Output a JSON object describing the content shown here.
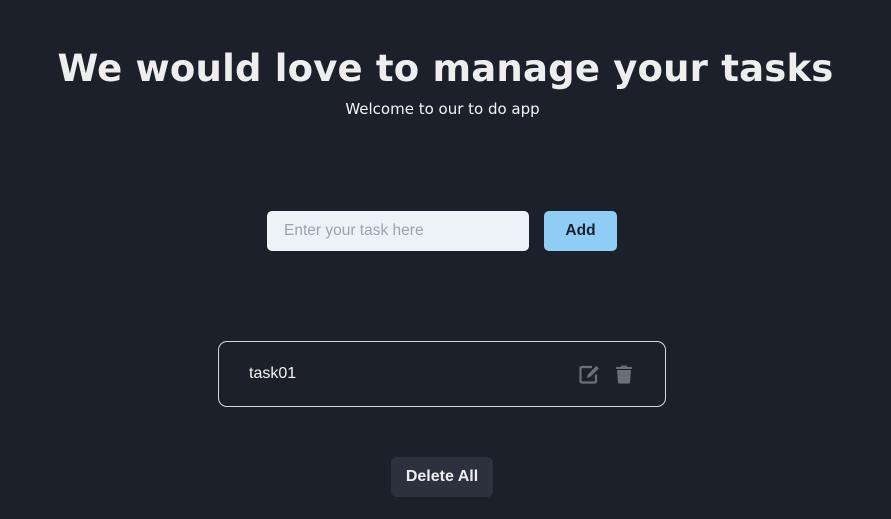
{
  "header": {
    "title": "We would love to manage your tasks",
    "subtitle": "Welcome to our to do app"
  },
  "form": {
    "input_value": "",
    "input_placeholder": "Enter your task here",
    "add_label": "Add"
  },
  "tasks": [
    {
      "text": "task01",
      "edit_icon": "edit-icon",
      "delete_icon": "trash-icon"
    }
  ],
  "footer": {
    "delete_all_label": "Delete All"
  },
  "colors": {
    "background": "#1b202b",
    "add_button": "#90cdf4",
    "input_background": "#edf2f7",
    "delete_all_button": "#2d313d",
    "icon": "#6b6f78"
  }
}
